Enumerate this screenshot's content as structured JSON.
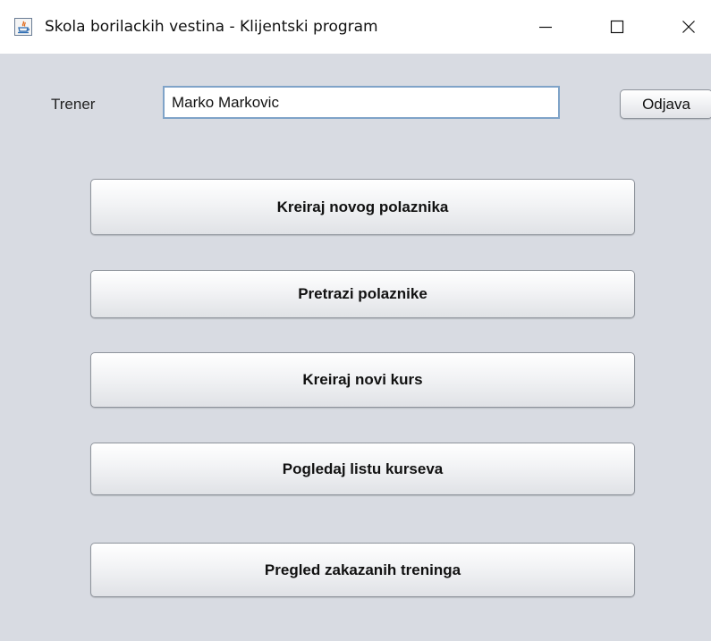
{
  "window": {
    "title": "Skola borilackih vestina - Klijentski program",
    "app_icon": "java-icon",
    "controls": {
      "minimize_icon": "minimize-icon",
      "maximize_icon": "maximize-icon",
      "close_icon": "close-icon"
    }
  },
  "header": {
    "trainer_label": "Trener",
    "trainer_value": "Marko Markovic",
    "logout_label": "Odjava"
  },
  "menu": {
    "buttons": [
      {
        "label": "Kreiraj novog polaznika"
      },
      {
        "label": "Pretrazi polaznike"
      },
      {
        "label": "Kreiraj novi kurs"
      },
      {
        "label": "Pogledaj listu kurseva"
      },
      {
        "label": "Pregled zakazanih treninga"
      }
    ]
  },
  "colors": {
    "window_background": "#d8dbe2",
    "titlebar_background": "#ffffff",
    "field_border": "#7fa3c8"
  }
}
